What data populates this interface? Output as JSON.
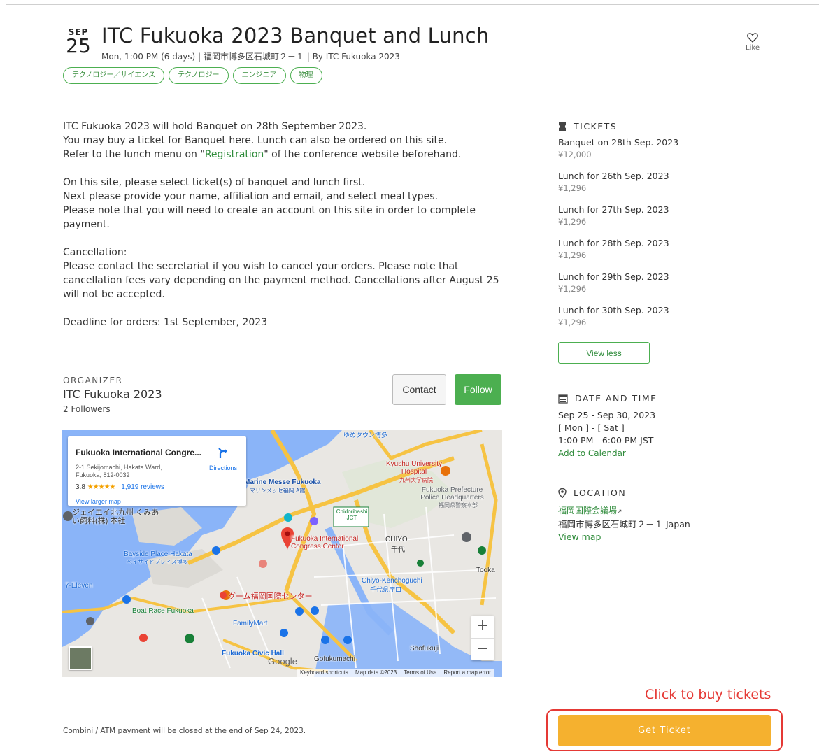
{
  "event": {
    "month": "SEP",
    "day": "25",
    "title": "ITC Fukuoka 2023 Banquet and Lunch",
    "subtitle": "Mon, 1:00 PM (6 days) | 福岡市博多区石城町２－１ | By ITC Fukuoka 2023",
    "tags": [
      "テクノロジー／サイエンス",
      "テクノロジー",
      "エンジニア",
      "物理"
    ],
    "like_label": "Like"
  },
  "description": {
    "p1_l1": "ITC Fukuoka 2023 will hold Banquet on 28th September 2023.",
    "p1_l2": "You may buy a ticket for Banquet here. Lunch can also be ordered on this site.",
    "p1_l3_pre": "Refer to the lunch menu on \"",
    "p1_l3_link": "Registration",
    "p1_l3_post": "\" of the conference website beforehand.",
    "p2_l1": "On this site, please select ticket(s) of banquet and lunch first.",
    "p2_l2": "Next please provide your name, affiliation and email, and select meal types.",
    "p2_l3": "Please note that you will need to create an account on this site in order to complete payment.",
    "p3_l1": "Cancellation:",
    "p3_l2": "Please contact the secretariat if you wish to cancel your orders. Please note that cancellation fees vary depending on the payment method. Cancellations after August 25 will not be accepted.",
    "p4_l1": "Deadline for orders: 1st September, 2023"
  },
  "organizer": {
    "label": "ORGANIZER",
    "name": "ITC Fukuoka 2023",
    "followers": "2 Followers",
    "contact_label": "Contact",
    "follow_label": "Follow"
  },
  "map": {
    "place_name": "Fukuoka International Congre...",
    "address": "2-1 Sekijomachi, Hakata Ward, Fukuoka, 812-0032",
    "rating": "3.8",
    "stars": "★★★★★",
    "reviews": "1,919 reviews",
    "directions": "Directions",
    "larger_map": "View larger map",
    "labels": {
      "marine_messe": "Marine Messe Fukuoka",
      "marine_messe_jp": "マリンメッセ福岡 A館",
      "kyushu": "Kyushu University Hospital",
      "kyushu_jp": "九州大学病院",
      "police": "Fukuoka Prefecture Police Headquarters",
      "police_jp": "福岡県警察本部",
      "congress": "Fukuoka International Congress Center",
      "chiyo": "CHIYO",
      "chiyo_jp": "千代",
      "bayside": "Bayside Place Hakata",
      "bayside_jp": "ベイサイドプレイス博多",
      "seven": "7-Eleven",
      "chiyo_kencho": "Chiyo-Kenchōguchi",
      "chiyo_kencho_jp": "千代県庁口",
      "gum": "グーム福岡国際センター",
      "boat": "Boat Race Fukuoka",
      "familymart": "FamilyMart",
      "civic": "Fukuoka Civic Hall",
      "gofuku": "Gofukumachi",
      "shofukuji": "Shofukuji",
      "jei": "ジェイエイ北九州 くみあい飼料(株) 本社",
      "yume": "ゆめタウン博多",
      "tookae": "Tooka",
      "chidori": "Chidoribashi JCT"
    },
    "google": "Google",
    "footer": [
      "Keyboard shortcuts",
      "Map data ©2023",
      "Terms of Use",
      "Report a map error"
    ]
  },
  "tickets": {
    "heading": "TICKETS",
    "items": [
      {
        "name": "Banquet on 28th Sep. 2023",
        "price": "¥12,000"
      },
      {
        "name": "Lunch for 26th Sep. 2023",
        "price": "¥1,296"
      },
      {
        "name": "Lunch for 27th Sep. 2023",
        "price": "¥1,296"
      },
      {
        "name": "Lunch for 28th Sep. 2023",
        "price": "¥1,296"
      },
      {
        "name": "Lunch for 29th Sep. 2023",
        "price": "¥1,296"
      },
      {
        "name": "Lunch for 30th Sep. 2023",
        "price": "¥1,296"
      }
    ],
    "view_less": "View less"
  },
  "datetime": {
    "heading": "DATE AND TIME",
    "range": "Sep 25 - Sep 30, 2023",
    "days": "[ Mon ] - [ Sat ]",
    "time": "1:00 PM - 6:00 PM JST",
    "add_calendar": "Add to Calendar"
  },
  "location": {
    "heading": "LOCATION",
    "venue": "福岡国際会議場",
    "address": "福岡市博多区石城町２－１ Japan",
    "view_map": "View map"
  },
  "footer": {
    "payment_note": "Combini / ATM payment will be closed at the end of Sep 24, 2023.",
    "annotation": "Click to buy tickets",
    "get_ticket": "Get Ticket"
  },
  "colors": {
    "accent_green": "#4caf50",
    "ticket_orange": "#f5b12f",
    "annotation_red": "#e53935"
  }
}
